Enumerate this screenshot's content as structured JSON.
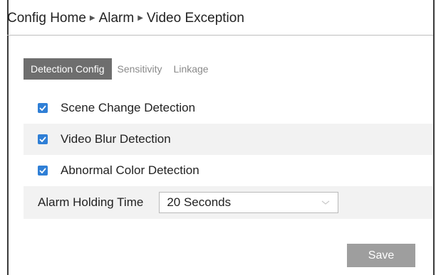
{
  "breadcrumb": {
    "items": [
      "Config Home",
      "Alarm",
      "Video Exception"
    ],
    "separator": "▶"
  },
  "tabs": [
    {
      "label": "Detection Config",
      "active": true
    },
    {
      "label": "Sensitivity",
      "active": false
    },
    {
      "label": "Linkage",
      "active": false
    }
  ],
  "options": [
    {
      "label": "Scene Change Detection",
      "checked": true
    },
    {
      "label": "Video Blur Detection",
      "checked": true
    },
    {
      "label": "Abnormal Color Detection",
      "checked": true
    }
  ],
  "alarm_holding": {
    "label": "Alarm Holding Time",
    "value": "20 Seconds"
  },
  "save_label": "Save",
  "colors": {
    "checkbox": "#2f7fd6",
    "active_tab": "#6e6e6e",
    "button": "#9e9e9e",
    "row_shade": "#f2f2f2"
  }
}
